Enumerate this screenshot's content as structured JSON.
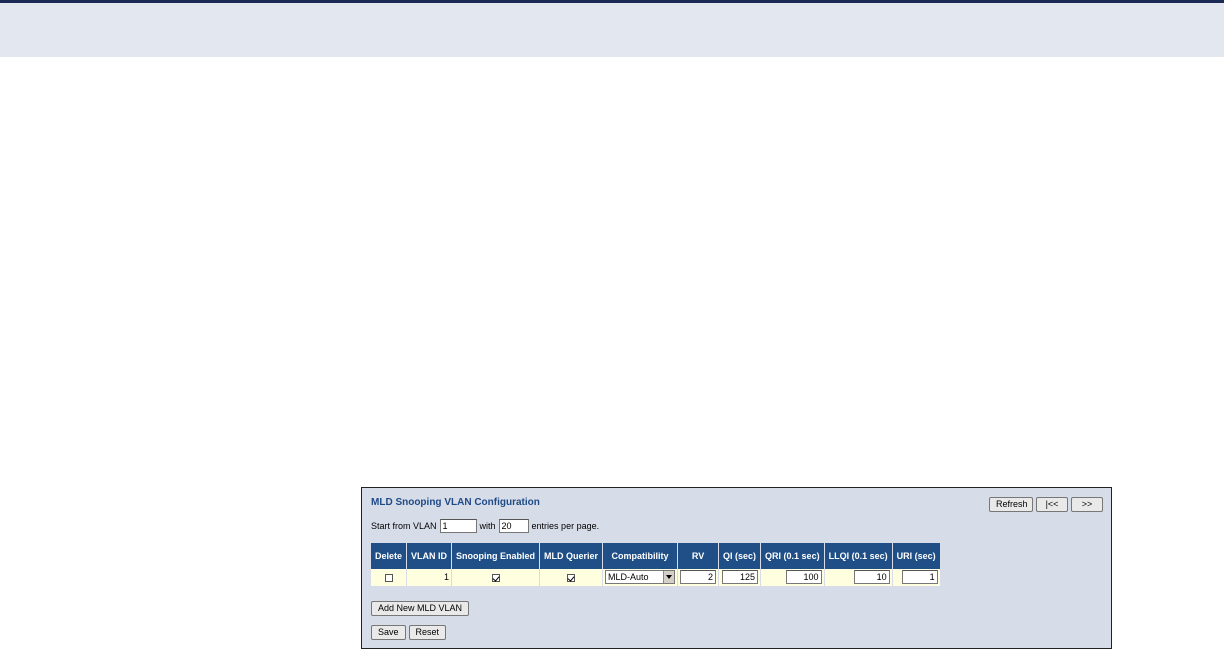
{
  "panel": {
    "title": "MLD Snooping VLAN Configuration",
    "nav": {
      "refresh": "Refresh",
      "first": "|<<",
      "next": ">>"
    },
    "start_prefix": "Start from VLAN",
    "start_value": "1",
    "with_label": "with",
    "entries_value": "20",
    "entries_suffix": "entries per page."
  },
  "table": {
    "headers": [
      "Delete",
      "VLAN ID",
      "Snooping Enabled",
      "MLD Querier",
      "Compatibility",
      "RV",
      "QI (sec)",
      "QRI (0.1 sec)",
      "LLQI (0.1 sec)",
      "URI (sec)"
    ],
    "rows": [
      {
        "delete": false,
        "vlan_id": "1",
        "snooping_enabled": true,
        "mld_querier": true,
        "compatibility": "MLD-Auto",
        "rv": "2",
        "qi": "125",
        "qri": "100",
        "llqi": "10",
        "uri": "1"
      }
    ]
  },
  "buttons": {
    "add_new": "Add New MLD VLAN",
    "save": "Save",
    "reset": "Reset"
  },
  "colors": {
    "header_bg": "#1f4f86",
    "row_bg": "#ffffe0",
    "panel_bg": "#d7dde8",
    "title_color": "#1e4a87"
  }
}
